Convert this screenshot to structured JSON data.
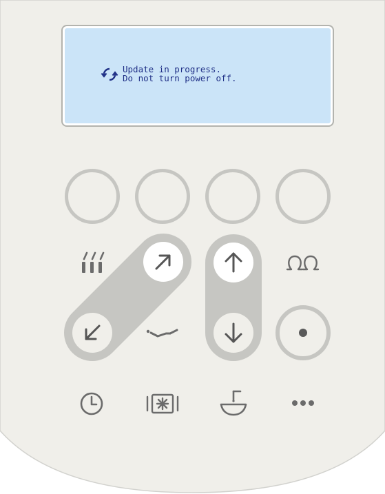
{
  "display": {
    "lines": [
      "Update in progress.",
      "Do not turn power off."
    ],
    "status_icon": "sync-icon",
    "text_color": "#1f2f86",
    "background_color": "#cbe4f8"
  },
  "panel": {
    "body_color": "#f0efea",
    "track_color": "#c6c6c2",
    "icon_color": "#6b6b6b"
  },
  "softkeys": [
    "softkey-1",
    "softkey-2",
    "softkey-3",
    "softkey-4"
  ],
  "buttons": {
    "heat": "heat-icon",
    "backrest_up": "arrow-up-right-icon",
    "backrest_down": "arrow-down-left-icon",
    "recline": "recline-icon",
    "seat_up": "arrow-up-icon",
    "seat_down": "arrow-down-icon",
    "users": "users-icon",
    "record": "dot-icon",
    "timer": "clock-icon",
    "light": "light-icon",
    "cup_filler": "cup-filler-icon",
    "more": "more-icon"
  }
}
